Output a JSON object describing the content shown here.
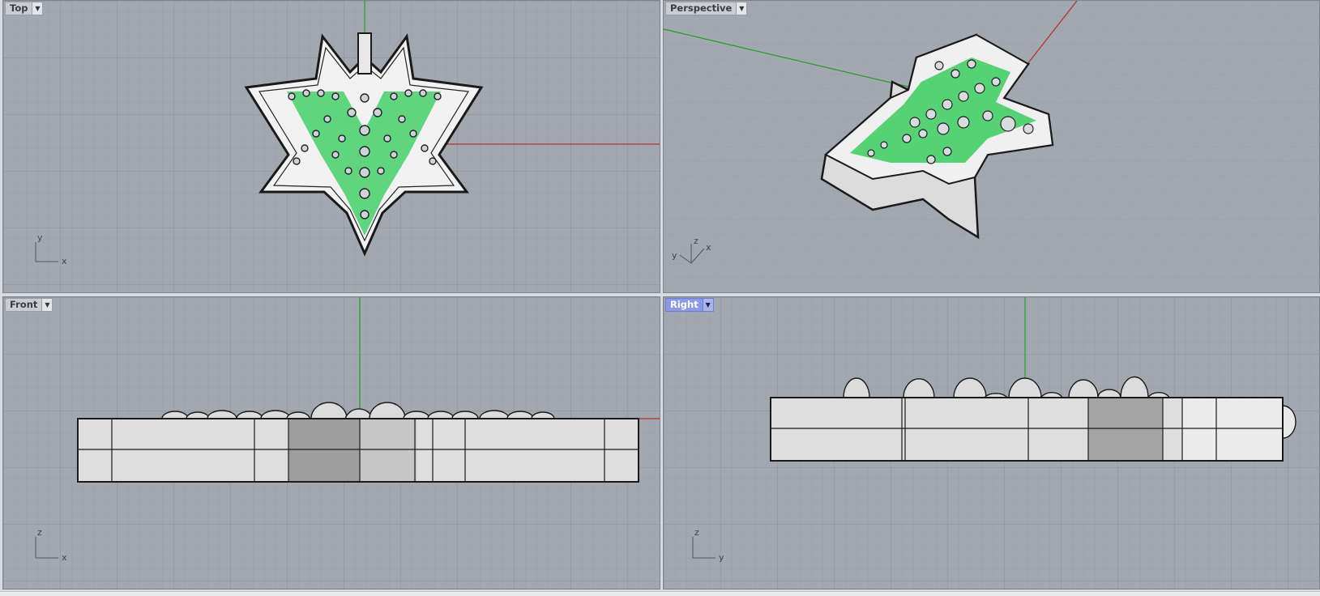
{
  "viewports": {
    "top": {
      "label": "Top",
      "axis_h": "x",
      "axis_v": "y"
    },
    "perspective": {
      "label": "Perspective",
      "axis_a": "y",
      "axis_b": "z",
      "axis_c": "x"
    },
    "front": {
      "label": "Front",
      "axis_h": "x",
      "axis_v": "z"
    },
    "right": {
      "label": "Right",
      "axis_h": "y",
      "axis_v": "z"
    }
  },
  "active_viewport": "Right",
  "icons": {
    "viewport_menu": "chevron-down-icon"
  },
  "colors": {
    "viewport_bg": "#a3a8b0",
    "grid_minor": "#99a0a8",
    "grid_major": "#8a9098",
    "x_axis": "#b03030",
    "y_axis": "#2a9a2a",
    "gem_green": "#2ecc55",
    "metal": "#e4e4e4",
    "active_tab": "#8a9ae8"
  }
}
